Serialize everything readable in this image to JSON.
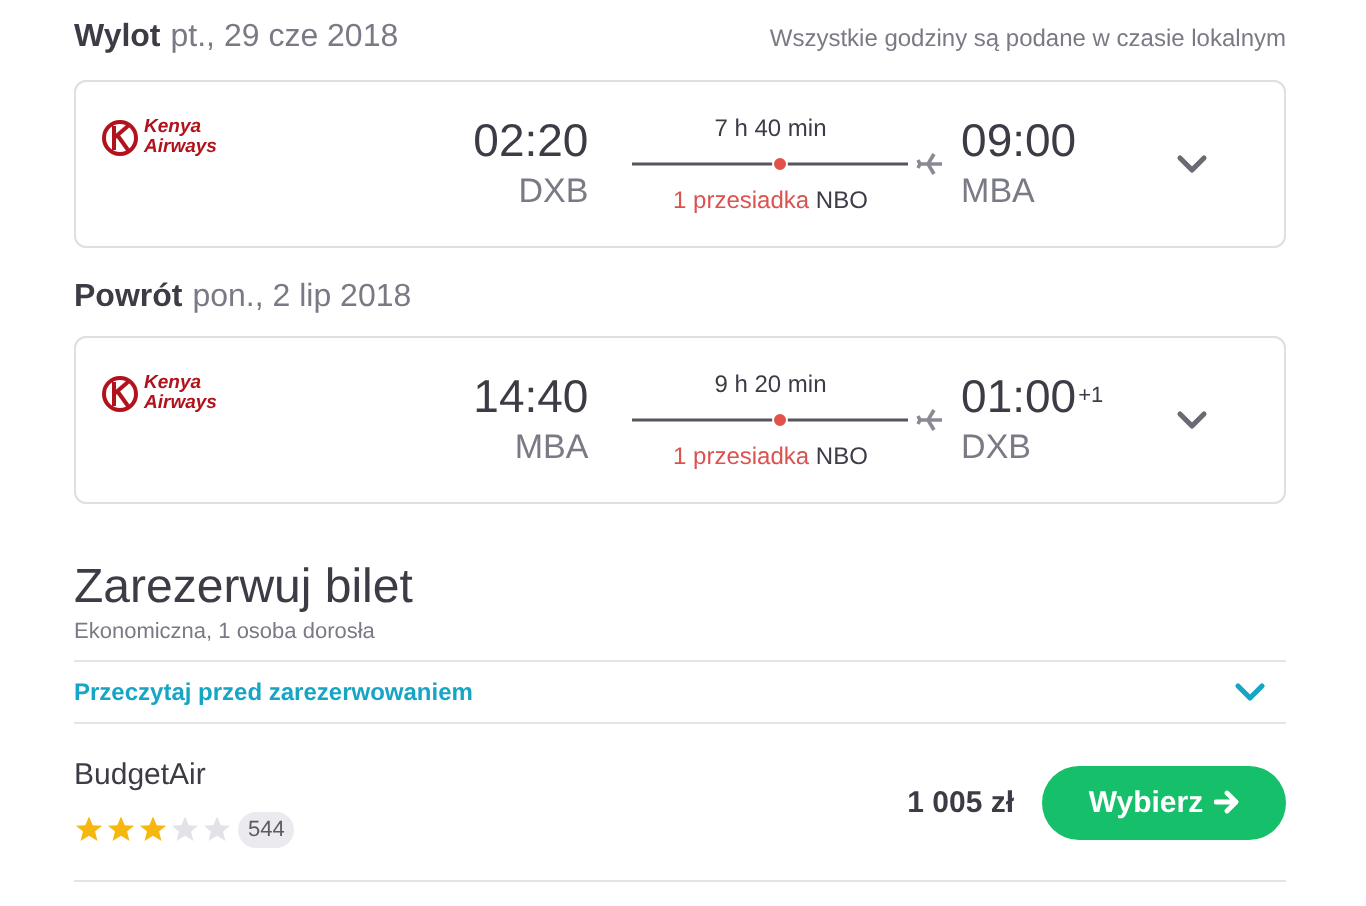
{
  "timezone_note": "Wszystkie godziny są podane w czasie lokalnym",
  "flights": [
    {
      "label": "Wylot",
      "date": "pt., 29 cze 2018",
      "airline": "Kenya Airways",
      "departure_time": "02:20",
      "departure_airport": "DXB",
      "duration": "7 h 40 min",
      "stops": "1 przesiadka",
      "stop_airport": "NBO",
      "arrival_time": "09:00",
      "arrival_airport": "MBA",
      "expanded": false
    },
    {
      "label": "Powrót",
      "date": "pon., 2 lip 2018",
      "airline": "Kenya Airways",
      "departure_time": "14:40",
      "departure_airport": "MBA",
      "duration": "9 h 20 min",
      "stops": "1 przesiadka",
      "stop_airport": "NBO",
      "arrival_time": "01:00",
      "arrival_day_offset": "+1",
      "arrival_airport": "DXB",
      "expanded": false
    }
  ],
  "booking": {
    "title": "Zarezerwuj bilet",
    "subtitle": "Ekonomiczna, 1 osoba dorosła",
    "info_link": "Przeczytaj przed zarezerwowaniem",
    "info_expanded": false,
    "offers": [
      {
        "provider": "BudgetAir",
        "stars": 3,
        "reviews": "544",
        "price": "1 005 zł",
        "button": "Wybierz"
      }
    ]
  }
}
